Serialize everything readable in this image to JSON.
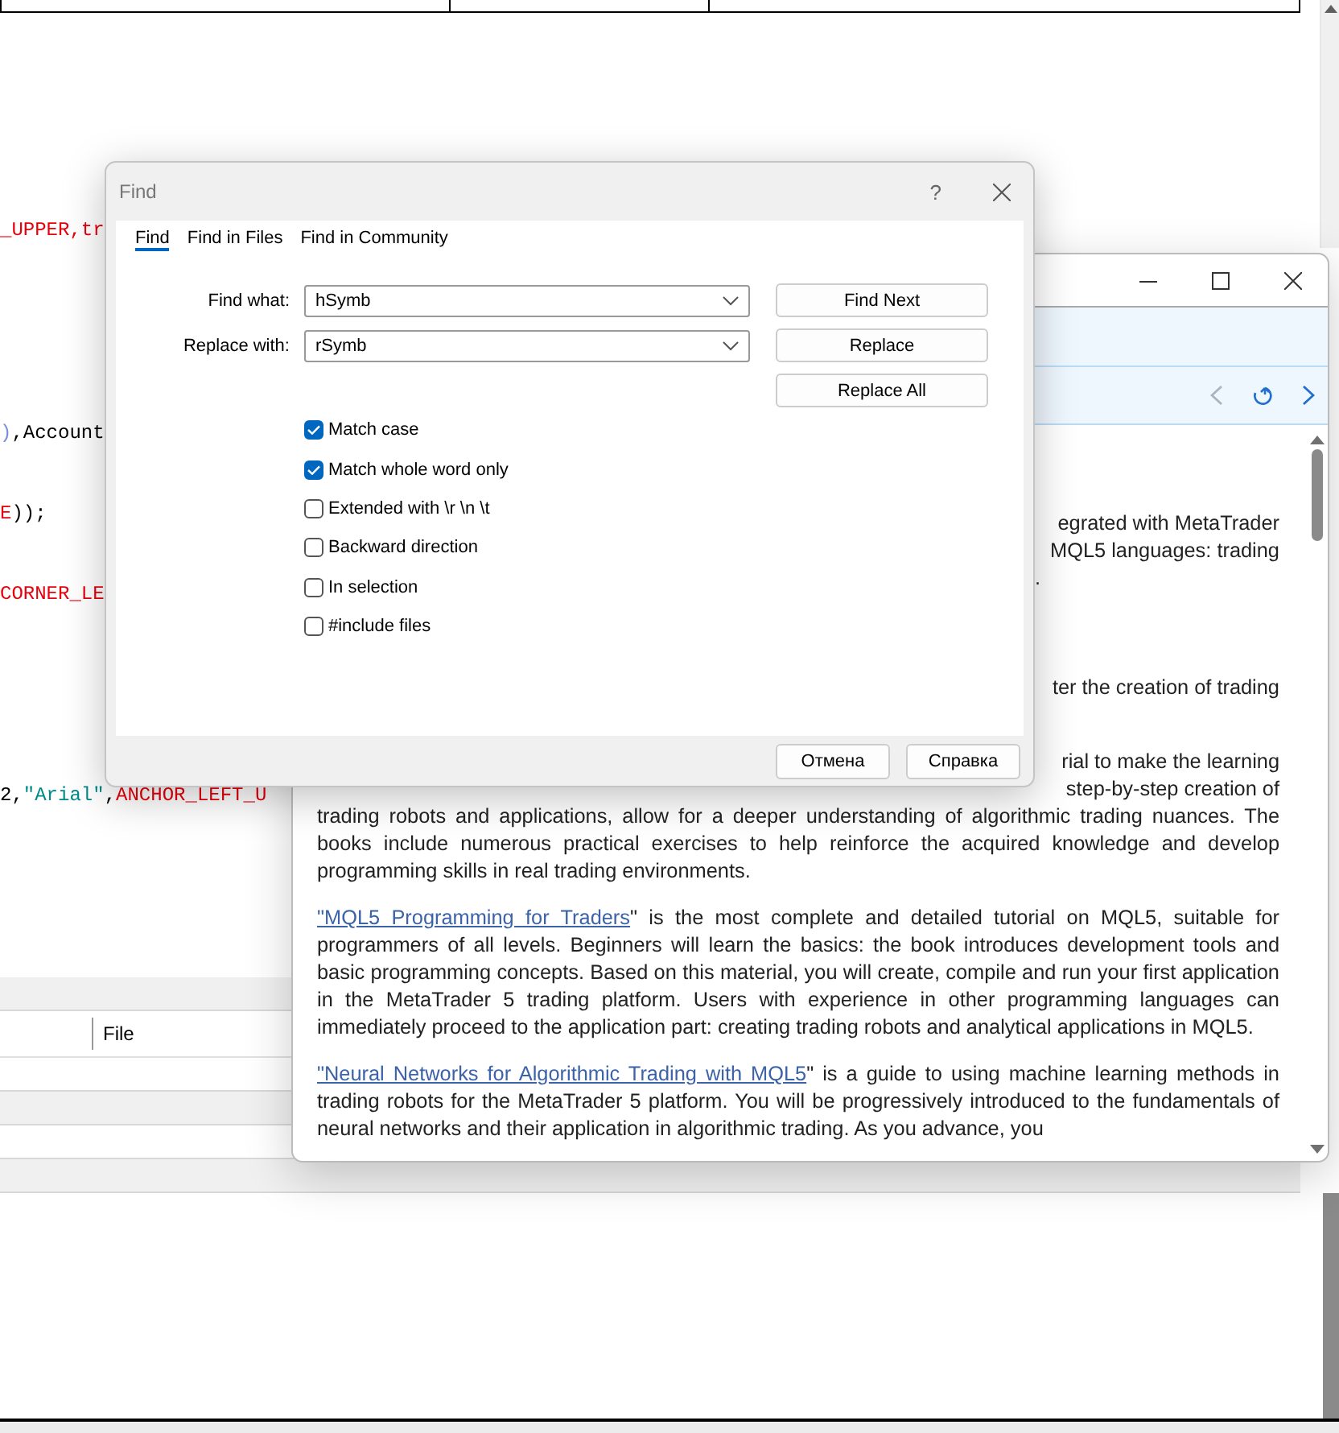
{
  "editor": {
    "code_lines": [
      {
        "tokens": [
          {
            "kind": "constant",
            "text": "_UPPER,tr"
          }
        ]
      },
      {
        "tokens": [
          {
            "kind": "paren",
            "text": ")"
          },
          {
            "kind": "plain",
            "text": ",Account"
          }
        ]
      },
      {
        "tokens": [
          {
            "kind": "constant",
            "text": "E"
          },
          {
            "kind": "plain",
            "text": "));"
          }
        ]
      },
      {
        "tokens": [
          {
            "kind": "constant",
            "text": "CORNER_LE"
          }
        ]
      },
      {
        "tokens": [
          {
            "kind": "plain",
            "text": "2,"
          },
          {
            "kind": "string",
            "text": "\"Arial\""
          },
          {
            "kind": "plain",
            "text": ","
          },
          {
            "kind": "constant",
            "text": "ANCHOR_LEFT_U"
          }
        ]
      }
    ]
  },
  "bottom_panel": {
    "columns": [
      "File"
    ]
  },
  "find_dialog": {
    "title": "Find",
    "help": "?",
    "tabs": [
      {
        "label": "Find",
        "selected": true
      },
      {
        "label": "Find in Files",
        "selected": false
      },
      {
        "label": "Find in Community",
        "selected": false
      }
    ],
    "fields": [
      {
        "label": "Find what:",
        "value": "hSymb"
      },
      {
        "label": "Replace with:",
        "value": "rSymb"
      }
    ],
    "actions": [
      "Find Next",
      "Replace",
      "Replace All"
    ],
    "options": [
      {
        "label": "Match case",
        "checked": true
      },
      {
        "label": "Match whole word only",
        "checked": true
      },
      {
        "label": "Extended with \\r \\n \\t",
        "checked": false
      },
      {
        "label": "Backward direction",
        "checked": false
      },
      {
        "label": "In selection",
        "checked": false
      },
      {
        "label": "#include files",
        "checked": false
      }
    ],
    "buttons": [
      "Отмена",
      "Справка"
    ]
  },
  "help_window": {
    "toolbar": [
      {
        "kind": "back",
        "disabled": true
      },
      {
        "kind": "refresh",
        "disabled": false
      },
      {
        "kind": "forward",
        "disabled": false
      }
    ],
    "fragments": [
      "egrated with MetaTrader",
      "MQL5 languages: trading",
      ".",
      "ter the creation of trading",
      "rial to make the learning",
      "step-by-step creation of"
    ],
    "paragraphs": [
      {
        "text": "trading robots and applications, allow for a deeper understanding of algorithmic trading nuances. The books include numerous practical exercises to help reinforce the acquired knowledge and develop programming skills in real trading environments."
      },
      {
        "link": "\"MQL5 Programming for Traders",
        "text": "\" is the most complete and detailed tutorial on MQL5, suitable for programmers of all levels. Beginners will learn the basics: the book introduces development tools and basic programming concepts. Based on this material, you will create, compile and run your first application in the MetaTrader 5 trading platform. Users with experience in other programming languages can immediately proceed to the application part: creating trading robots and analytical applications in MQL5."
      },
      {
        "link": "\"Neural Networks for Algorithmic Trading with MQL5",
        "text": "\" is a guide to using machine learning methods in trading robots for the MetaTrader 5 platform. You will be progressively introduced to the fundamentals of neural networks and their application in algorithmic trading. As you advance, you"
      }
    ]
  }
}
